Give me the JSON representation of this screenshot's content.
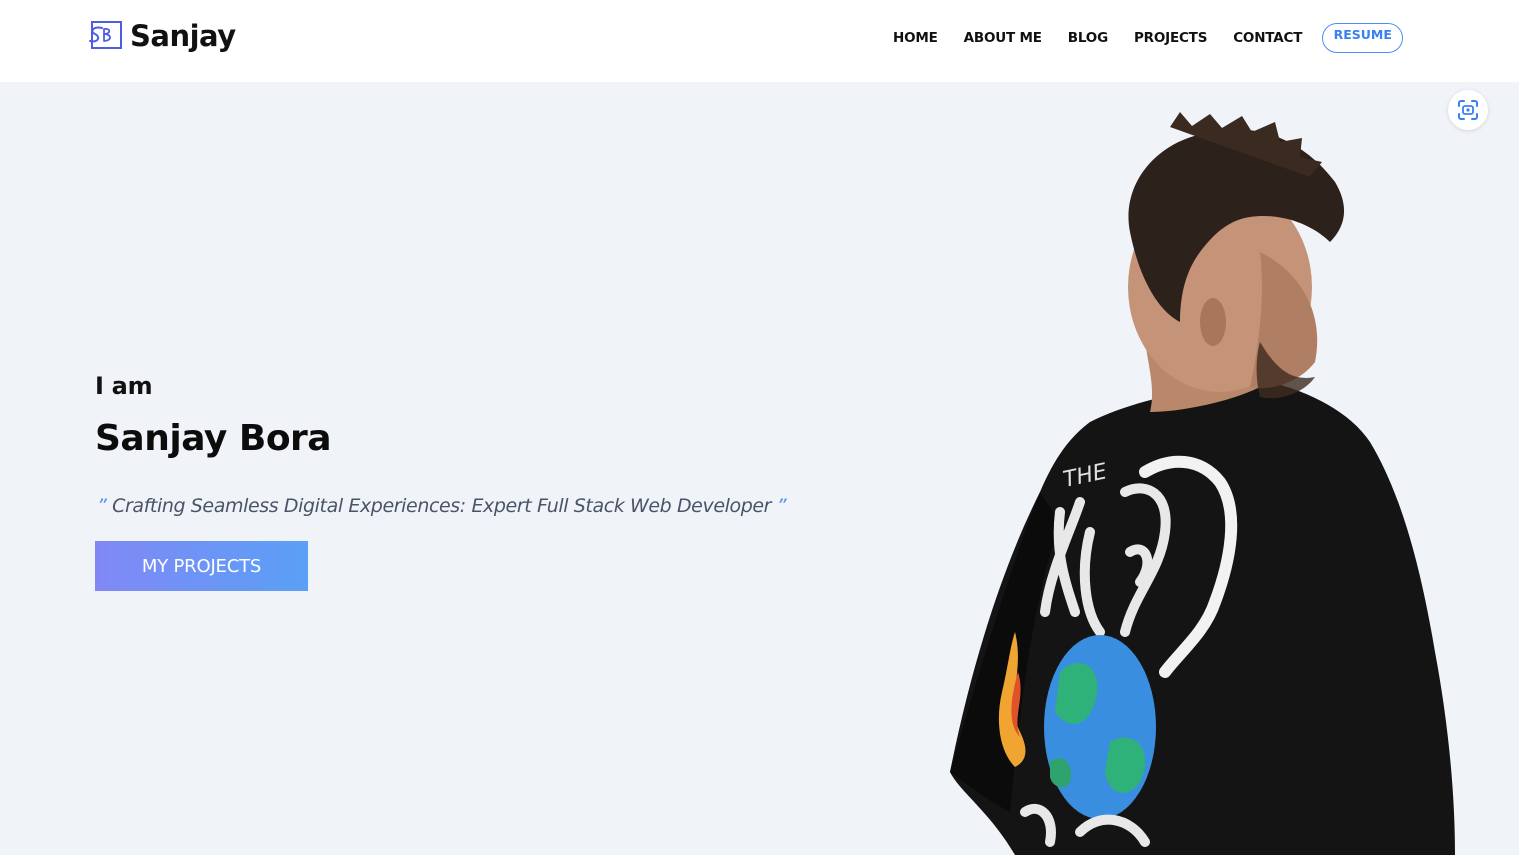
{
  "header": {
    "logo_text": "Sanjay",
    "nav": [
      "HOME",
      "ABOUT ME",
      "BLOG",
      "PROJECTS",
      "CONTACT"
    ],
    "resume_label": "RESUME"
  },
  "hero": {
    "intro": "I am",
    "name": "Sanjay Bora",
    "quote_open": "”",
    "tagline": "Crafting Seamless Digital Experiences: Expert Full Stack Web Developer",
    "quote_close": "”",
    "cta_label": "MY PROJECTS",
    "scan_icon": "scan-icon",
    "portrait": "portrait-photo"
  },
  "colors": {
    "accent": "#4f8ef7",
    "cta_start": "#8188f5",
    "cta_end": "#5aa0f6",
    "background": "#f0f3f8"
  }
}
